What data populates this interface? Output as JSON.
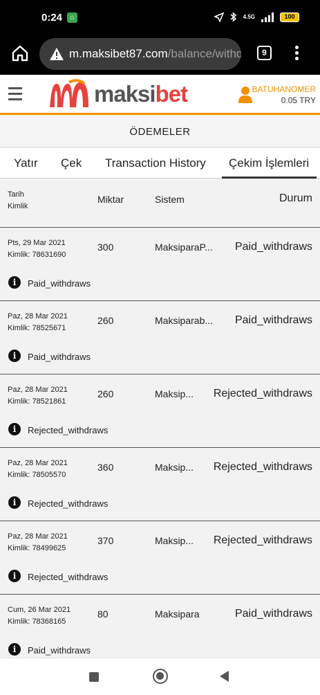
{
  "status_bar": {
    "time": "0:24",
    "network": "4.5G",
    "battery": "100"
  },
  "browser": {
    "url_host": "m.maksibet87.com",
    "url_path": "/balance/withdr",
    "tabs_count": "9"
  },
  "header": {
    "logo_text_a": "maksi",
    "logo_text_b": "bet",
    "username": "BATUHANOMER",
    "balance": "0.05 TRY"
  },
  "page_title": "ÖDEMELER",
  "tabs": [
    {
      "label": "Yatır"
    },
    {
      "label": "Çek"
    },
    {
      "label": "Transaction History"
    },
    {
      "label": "Çekim İşlemleri"
    }
  ],
  "table": {
    "headers": {
      "date": "Tarih",
      "id": "Kimlik",
      "amount": "Miktar",
      "system": "Sistem",
      "status": "Durum"
    },
    "rows": [
      {
        "date": "Pts, 29 Mar 2021",
        "id": "Kimlik: 78631690",
        "amount": "300",
        "system": "MaksiparaP...",
        "status": "Paid_withdraws",
        "info": "Paid_withdraws"
      },
      {
        "date": "Paz, 28 Mar 2021",
        "id": "Kimlik: 78525671",
        "amount": "260",
        "system": "Maksiparab...",
        "status": "Paid_withdraws",
        "info": "Paid_withdraws"
      },
      {
        "date": "Paz, 28 Mar 2021",
        "id": "Kimlik: 78521861",
        "amount": "260",
        "system": "Maksip...",
        "status": "Rejected_withdraws",
        "info": "Rejected_withdraws"
      },
      {
        "date": "Paz, 28 Mar 2021",
        "id": "Kimlik: 78505570",
        "amount": "360",
        "system": "Maksip...",
        "status": "Rejected_withdraws",
        "info": "Rejected_withdraws"
      },
      {
        "date": "Paz, 28 Mar 2021",
        "id": "Kimlik: 78499625",
        "amount": "370",
        "system": "Maksip...",
        "status": "Rejected_withdraws",
        "info": "Rejected_withdraws"
      },
      {
        "date": "Cum, 26 Mar 2021",
        "id": "Kimlik: 78368165",
        "amount": "80",
        "system": "Maksipara",
        "status": "Paid_withdraws",
        "info": "Paid_withdraws"
      }
    ]
  }
}
